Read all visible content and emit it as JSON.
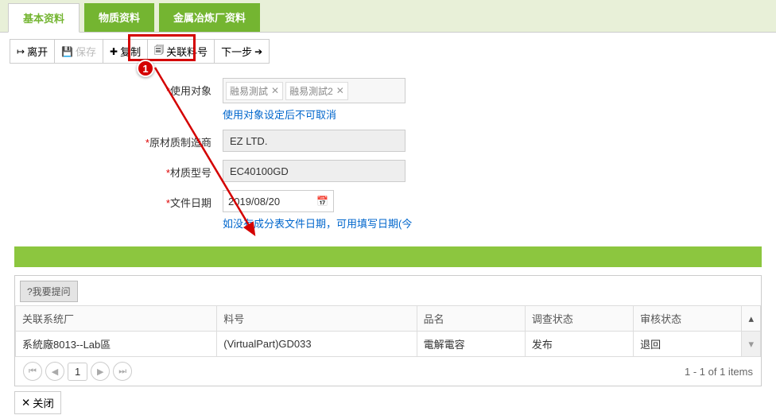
{
  "tabs": {
    "basic": "基本资料",
    "material": "物质资料",
    "smelter": "金属冶炼厂资料"
  },
  "toolbar": {
    "leave": "离开",
    "save": "保存",
    "copy": "复制",
    "link_part": "关联料号",
    "next": "下一步"
  },
  "callout": {
    "num1": "1"
  },
  "form": {
    "use_target_label": "使用对象",
    "use_target_tags": [
      "融易測試",
      "融易測試2"
    ],
    "use_target_hint": "使用对象设定后不可取消",
    "mfr_label": "原材质制造商",
    "mfr_value": "EZ LTD.",
    "model_label": "材质型号",
    "model_value": "EC40100GD",
    "doc_date_label": "文件日期",
    "doc_date_value": "2019/08/20",
    "doc_date_hint": "如没有成分表文件日期，可用填写日期(今"
  },
  "lower": {
    "ask_label": "?我要提问",
    "cols": {
      "factory": "关联系统厂",
      "partno": "料号",
      "name": "品名",
      "survey": "调查状态",
      "audit": "审核状态"
    },
    "rows": [
      {
        "factory": "系統廠8013--Lab區",
        "partno": "(VirtualPart)GD033",
        "name": "電解電容",
        "survey": "发布",
        "audit": "退回"
      }
    ],
    "pager": {
      "page": "1",
      "summary": "1 - 1 of 1 items"
    }
  },
  "close_label": "关闭"
}
